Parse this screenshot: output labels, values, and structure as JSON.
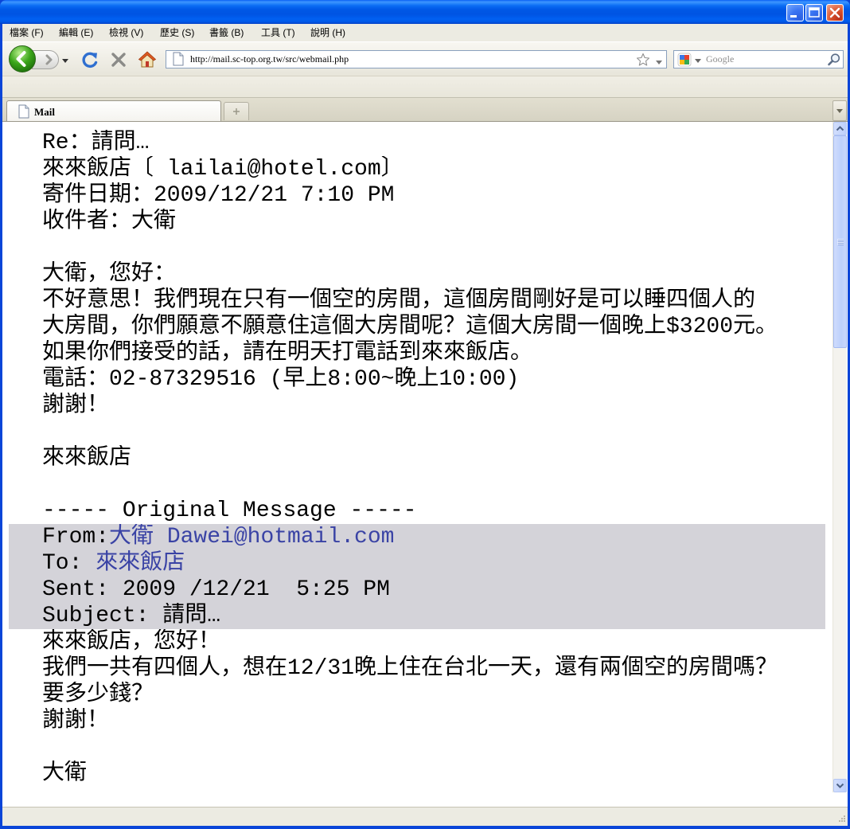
{
  "menu": [
    {
      "label": "檔案 (F)"
    },
    {
      "label": "編輯 (E)"
    },
    {
      "label": "檢視 (V)"
    },
    {
      "label": "歷史 (S)"
    },
    {
      "label": "書籤 (B)"
    },
    {
      "label": "工具 (T)"
    },
    {
      "label": "說明 (H)"
    }
  ],
  "nav": {
    "url": "http://mail.sc-top.org.tw/src/webmail.php",
    "search_placeholder": "Google"
  },
  "tabs": [
    {
      "label": "Mail"
    }
  ],
  "email": {
    "subject_line": "Re：請問…",
    "sender_line": "來來飯店〔 lailai@hotel.com〕",
    "date_line": "寄件日期：2009/12/21 7:10 PM",
    "recipient_line": "收件者：大衛",
    "reply_body": [
      "大衛，您好：",
      "不好意思！我們現在只有一個空的房間，這個房間剛好是可以睡四個人的",
      "大房間，你們願意不願意住這個大房間呢？這個大房間一個晚上$3200元。",
      "如果你們接受的話，請在明天打電話到來來飯店。",
      "電話：02-87329516 (早上8:00~晚上10:00)",
      "謝謝！"
    ],
    "reply_signature": "來來飯店",
    "original_divider": "----- Original Message -----",
    "original_header": {
      "from_label": "From:",
      "from_value": "大衛 Dawei@hotmail.com",
      "to_label": "To: ",
      "to_value": "來來飯店",
      "sent_line": "Sent: 2009 /12/21  5:25 PM",
      "subject_line": "Subject: 請問…"
    },
    "original_body": [
      "來來飯店，您好！",
      "我們一共有四個人，想在12/31晚上住在台北一天，還有兩個空的房間嗎？",
      "要多少錢？",
      "謝謝！"
    ],
    "original_signature": "大衛"
  },
  "scrollbar": {
    "position": 0,
    "visible_fraction": 0.33
  },
  "icons": [
    "minimize-icon",
    "maximize-icon",
    "close-icon",
    "back-arrow-icon",
    "forward-arrow-icon",
    "chevron-down-icon",
    "reload-icon",
    "stop-icon",
    "home-icon",
    "page-icon",
    "bookmark-star-icon",
    "google-icon",
    "search-icon",
    "plus-icon",
    "resize-grip-icon"
  ],
  "colors": {
    "link": "#3a43a5",
    "quoted_header_bg": "#d4d3d9",
    "close_button": "#d9532c"
  }
}
